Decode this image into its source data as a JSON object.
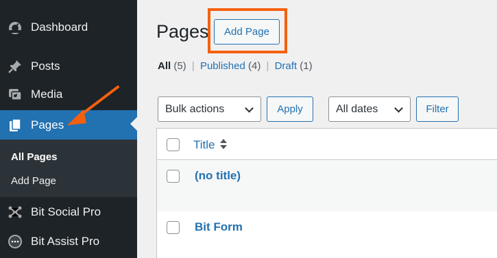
{
  "sidebar": {
    "items": [
      {
        "label": "Dashboard",
        "icon": "dashboard-icon"
      },
      {
        "label": "Posts",
        "icon": "pin-icon"
      },
      {
        "label": "Media",
        "icon": "media-icon"
      },
      {
        "label": "Pages",
        "icon": "pages-icon"
      }
    ],
    "submenu": [
      {
        "label": "All Pages"
      },
      {
        "label": "Add Page"
      }
    ],
    "plugins": [
      {
        "label": "Bit Social Pro",
        "icon": "bit-social-icon"
      },
      {
        "label": "Bit Assist Pro",
        "icon": "bit-assist-icon"
      }
    ]
  },
  "main": {
    "title": "Pages",
    "add_button": "Add Page",
    "filters": {
      "all": "All",
      "all_count": "(5)",
      "published": "Published",
      "published_count": "(4)",
      "draft": "Draft",
      "draft_count": "(1)",
      "separator": "|"
    },
    "bulk_actions": "Bulk actions",
    "apply": "Apply",
    "dates": "All dates",
    "filter": "Filter",
    "table": {
      "column_title": "Title",
      "rows": [
        {
          "title": "(no title)"
        },
        {
          "title": "Bit Form"
        }
      ]
    }
  },
  "colors": {
    "accent": "#2271b1",
    "highlight": "#f5600e",
    "sidebar_bg": "#1d2327"
  }
}
